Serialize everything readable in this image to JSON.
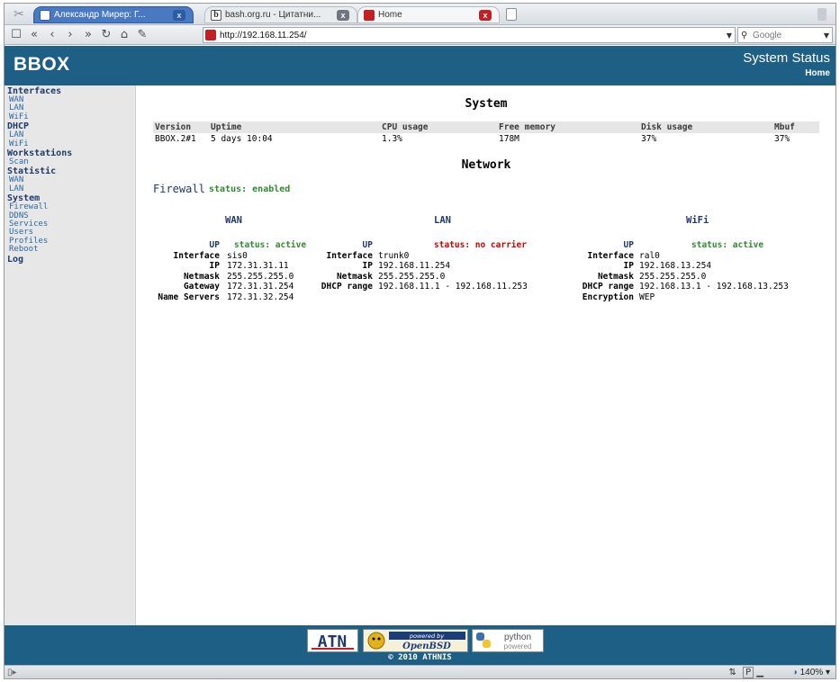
{
  "browser": {
    "tabs": [
      {
        "label": "Александр Мирер: Г..."
      },
      {
        "label": "bash.org.ru - Цитатни..."
      },
      {
        "label": "Home"
      }
    ],
    "url": "http://192.168.11.254/",
    "search_placeholder": "Google",
    "zoom": "140%",
    "status_p": "P"
  },
  "header": {
    "logo": "BBOX",
    "title": "System Status",
    "home_link": "Home"
  },
  "sidebar": {
    "sections": [
      {
        "title": "Interfaces",
        "items": [
          "WAN",
          "LAN",
          "WiFi"
        ]
      },
      {
        "title": "DHCP",
        "items": [
          "LAN",
          "WiFi"
        ]
      },
      {
        "title": "Workstations",
        "items": [
          "Scan"
        ]
      },
      {
        "title": "Statistic",
        "items": [
          "WAN",
          "LAN"
        ]
      },
      {
        "title": "System",
        "items": [
          "Firewall",
          "DDNS",
          "Services",
          "Users",
          "Profiles",
          "Reboot"
        ]
      },
      {
        "title": "Log",
        "items": []
      }
    ]
  },
  "system": {
    "heading": "System",
    "columns": [
      "Version",
      "Uptime",
      "CPU usage",
      "Free memory",
      "Disk usage",
      "Mbuf"
    ],
    "row": [
      "BBOX.2#1",
      "5 days 10:04",
      "1.3%",
      "178M",
      "37%",
      "37%"
    ]
  },
  "network": {
    "heading": "Network",
    "firewall_label": "Firewall",
    "firewall_status": "status: enabled",
    "wan": {
      "title": "WAN",
      "up": "UP",
      "status": "status: active",
      "rows": [
        {
          "key": "Interface",
          "value": "sis0"
        },
        {
          "key": "IP",
          "value": "172.31.31.11"
        },
        {
          "key": "Netmask",
          "value": "255.255.255.0"
        },
        {
          "key": "Gateway",
          "value": "172.31.31.254"
        },
        {
          "key": "Name Servers",
          "value": "172.31.32.254"
        }
      ]
    },
    "lan": {
      "title": "LAN",
      "up": "UP",
      "status": "status: no carrier",
      "rows": [
        {
          "key": "Interface",
          "value": "trunk0"
        },
        {
          "key": "IP",
          "value": "192.168.11.254"
        },
        {
          "key": "Netmask",
          "value": "255.255.255.0"
        },
        {
          "key": "DHCP range",
          "value": "192.168.11.1 - 192.168.11.253"
        }
      ]
    },
    "wifi": {
      "title": "WiFi",
      "up": "UP",
      "status": "status: active",
      "rows": [
        {
          "key": "Interface",
          "value": "ral0"
        },
        {
          "key": "IP",
          "value": "192.168.13.254"
        },
        {
          "key": "Netmask",
          "value": "255.255.255.0"
        },
        {
          "key": "DHCP range",
          "value": "192.168.13.1 - 192.168.13.253"
        },
        {
          "key": "Encryption",
          "value": "WEP"
        }
      ]
    }
  },
  "footer": {
    "badge_ath": "ATN",
    "badge_obsd_top": "powered by",
    "badge_obsd_main": "OpenBSD",
    "badge_py_top": "python",
    "badge_py_bottom": "powered",
    "copyright": "© 2010 ATHNIS"
  },
  "colors": {
    "header_bg": "#1d5f85",
    "sidebar_bg": "#e7e7e7",
    "link": "#2d67a6",
    "status_active": "#2e8b2e",
    "status_error": "#cc0000"
  }
}
